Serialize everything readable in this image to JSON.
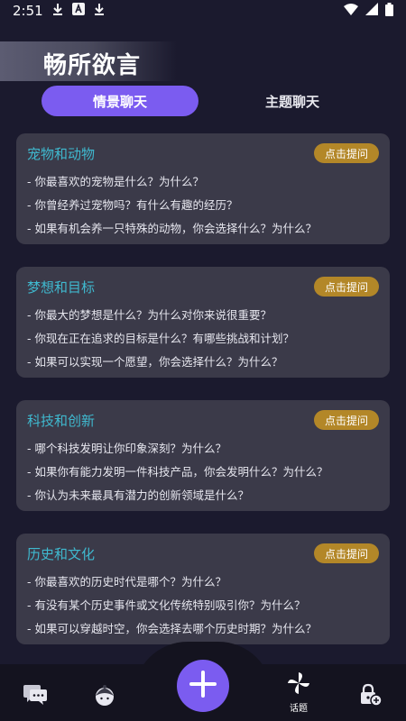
{
  "status_bar": {
    "time": "2:51",
    "icons": [
      "download-icon",
      "a-box-icon",
      "download-icon"
    ],
    "right_icons": [
      "wifi-icon",
      "signal-icon",
      "battery-icon"
    ]
  },
  "header": {
    "title": "畅所欲言"
  },
  "tabs": [
    {
      "label": "情景聊天",
      "active": true
    },
    {
      "label": "主题聊天",
      "active": false
    }
  ],
  "cards": [
    {
      "title": "宠物和动物",
      "button": "点击提问",
      "questions": [
        "- 你最喜欢的宠物是什么？为什么？",
        "- 你曾经养过宠物吗？有什么有趣的经历？",
        "- 如果有机会养一只特殊的动物，你会选择什么？为什么？"
      ]
    },
    {
      "title": "梦想和目标",
      "button": "点击提问",
      "questions": [
        "- 你最大的梦想是什么？为什么对你来说很重要？",
        "- 你现在正在追求的目标是什么？有哪些挑战和计划？",
        "- 如果可以实现一个愿望，你会选择什么？为什么？"
      ]
    },
    {
      "title": "科技和创新",
      "button": "点击提问",
      "questions": [
        "- 哪个科技发明让你印象深刻？为什么？",
        "- 如果你有能力发明一件科技产品，你会发明什么？为什么？",
        "- 你认为未来最具有潜力的创新领域是什么？"
      ]
    },
    {
      "title": "历史和文化",
      "button": "点击提问",
      "questions": [
        "- 你最喜欢的历史时代是哪个？为什么？",
        "- 有没有某个历史事件或文化传统特别吸引你？为什么？",
        "- 如果可以穿越时空，你会选择去哪个历史时期？为什么？"
      ]
    }
  ],
  "bottom_nav": {
    "items": [
      {
        "icon": "chat-icon"
      },
      {
        "icon": "avatar-icon"
      },
      {
        "icon": "pinwheel-icon",
        "label": "话题"
      },
      {
        "icon": "lock-plus-icon"
      }
    ],
    "fab_icon": "plus-icon"
  },
  "colors": {
    "accent": "#7b5cf0",
    "card_bg": "#3b3a49",
    "title_teal": "#3fb9cf",
    "button_gold": "#b38728",
    "background": "#1b1a2e"
  }
}
